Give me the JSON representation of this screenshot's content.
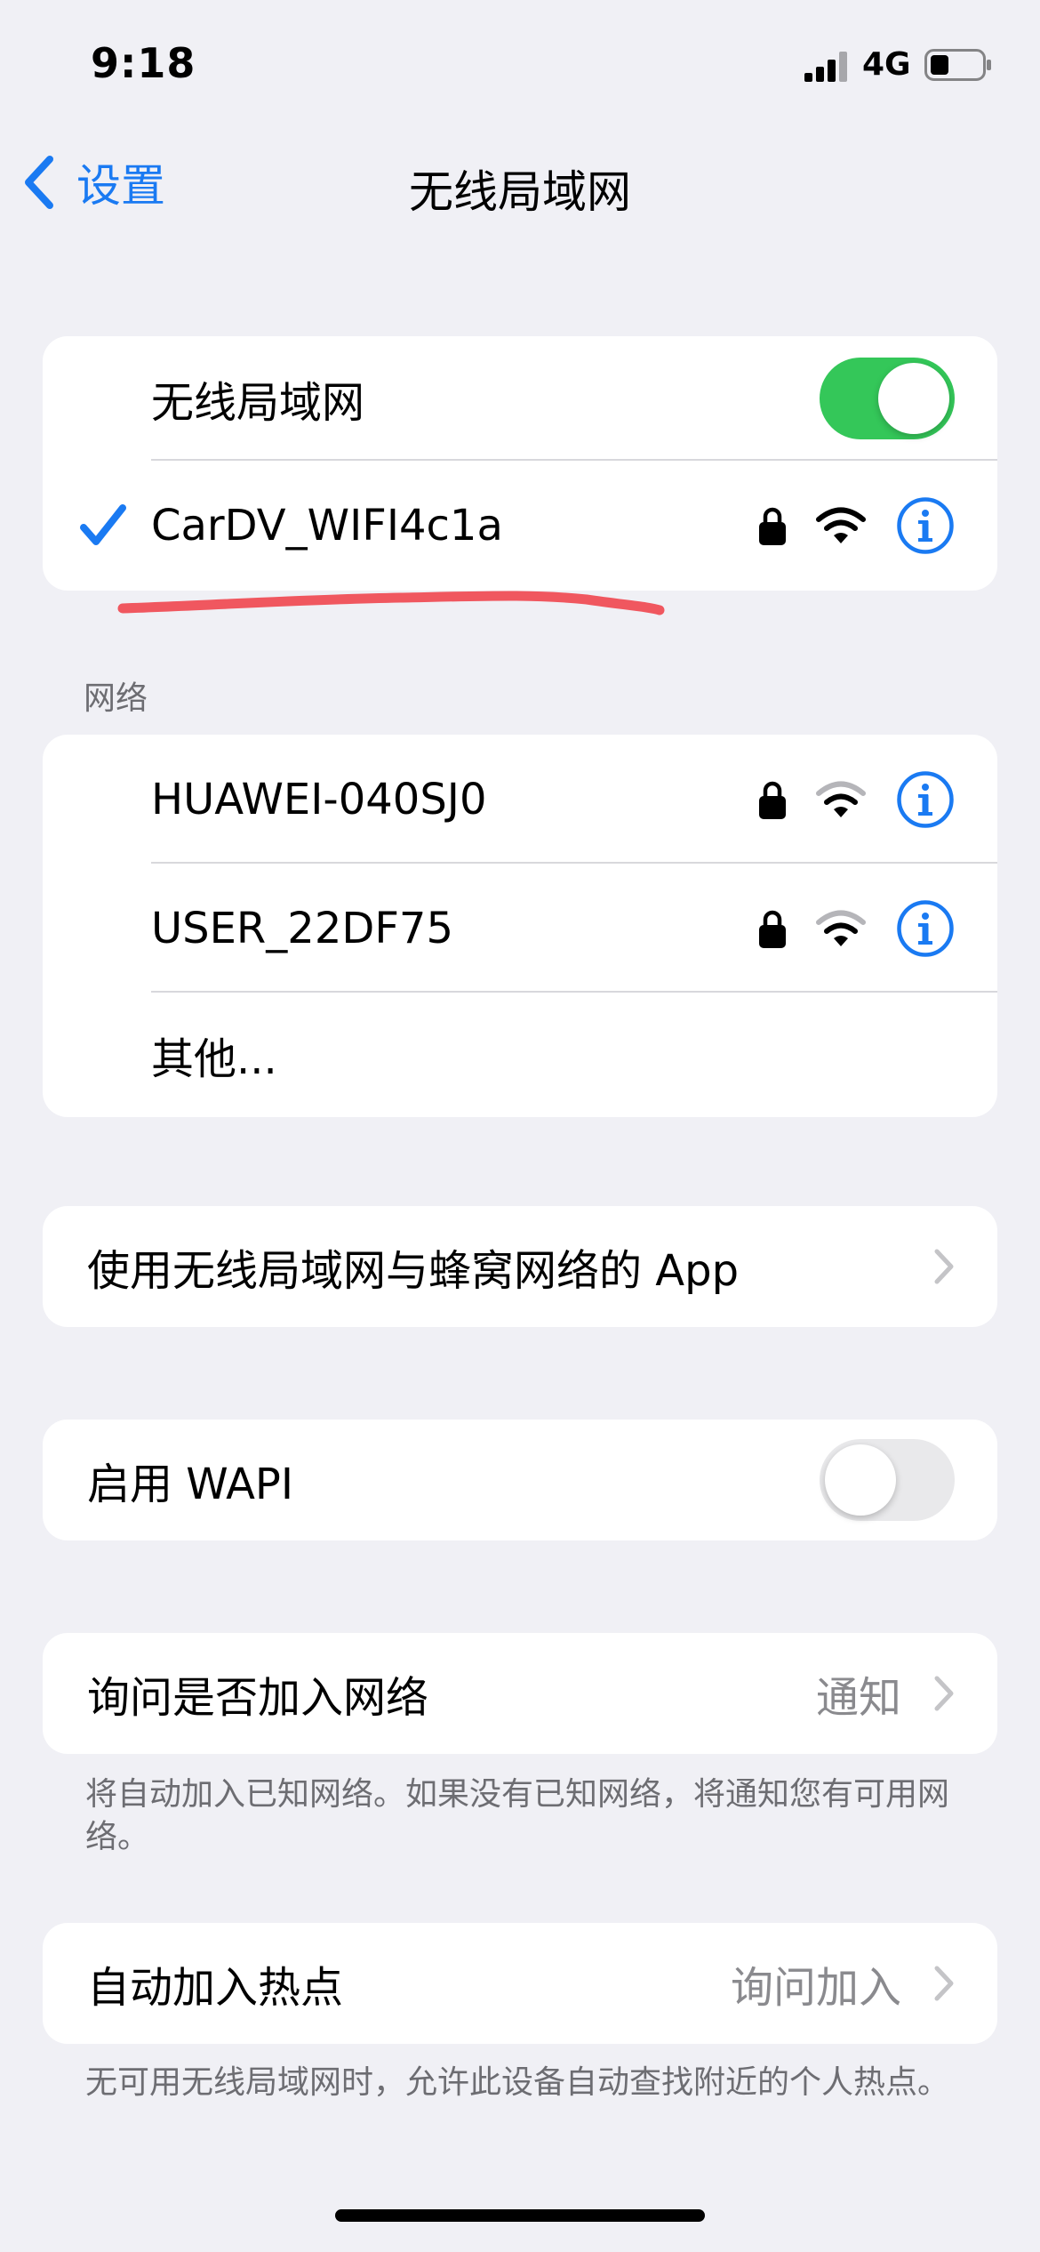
{
  "status_bar": {
    "time": "9:18",
    "network": "4G"
  },
  "nav": {
    "back_label": "设置",
    "title": "无线局域网"
  },
  "wifi_group": {
    "toggle_label": "无线局域网",
    "toggle_on": true,
    "connected_network": "CarDV_WIFI4c1a"
  },
  "networks_section": {
    "header": "网络",
    "items": [
      {
        "name": "HUAWEI-040SJ0",
        "secured": true
      },
      {
        "name": "USER_22DF75",
        "secured": true
      }
    ],
    "other_label": "其他..."
  },
  "apps_row": {
    "label": "使用无线局域网与蜂窝网络的 App"
  },
  "wapi_row": {
    "label": "启用 WAPI",
    "toggle_on": false
  },
  "ask_join": {
    "label": "询问是否加入网络",
    "value": "通知",
    "footnote": "将自动加入已知网络。如果没有已知网络，将通知您有可用网络。"
  },
  "hotspot": {
    "label": "自动加入热点",
    "value": "询问加入",
    "footnote": "无可用无线局域网时，允许此设备自动查找附近的个人热点。"
  },
  "colors": {
    "accent": "#1a7af2",
    "toggle_on": "#34c759",
    "annotation": "#f0575f"
  }
}
